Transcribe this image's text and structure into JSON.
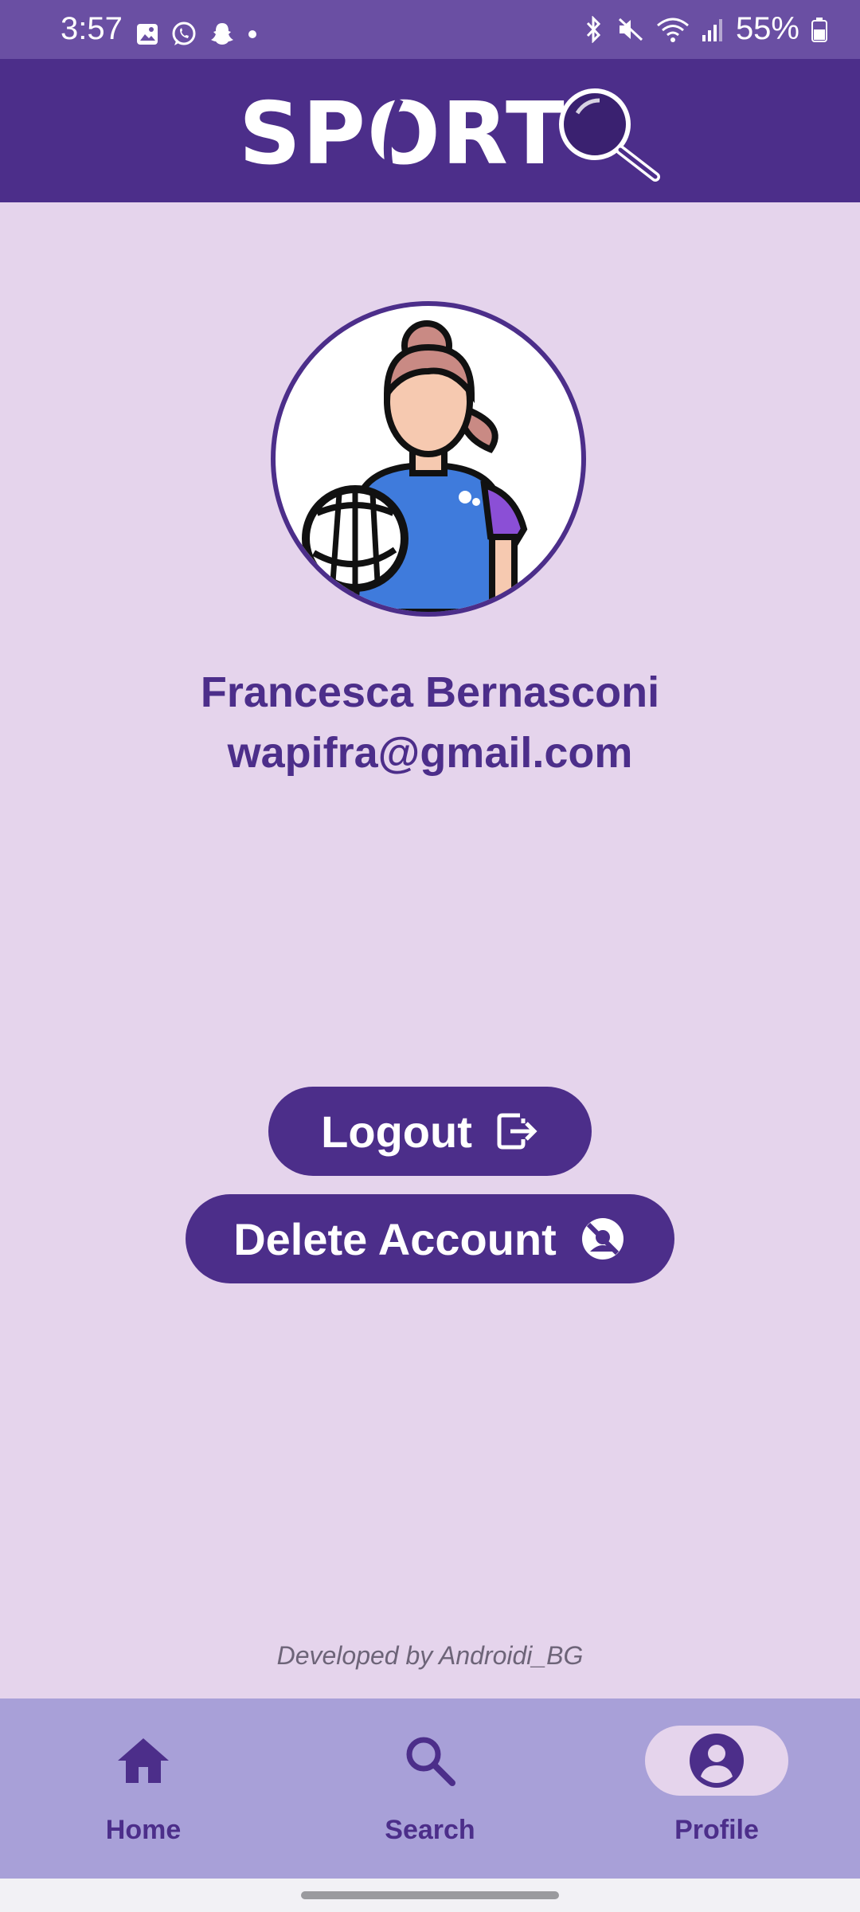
{
  "status_bar": {
    "time": "3:57",
    "battery": "55%",
    "left_icons": [
      "image-icon",
      "whatsapp-icon",
      "snapchat-icon",
      "dot-icon"
    ],
    "right_icons": [
      "bluetooth-icon",
      "mute-icon",
      "wifi-icon",
      "signal-icon",
      "battery-icon"
    ]
  },
  "header": {
    "logo_text": "SPORT"
  },
  "profile": {
    "name": "Francesca Bernasconi",
    "email": "wapifra@gmail.com"
  },
  "actions": {
    "logout_label": "Logout",
    "delete_label": "Delete Account"
  },
  "footer": {
    "credit": "Developed by Androidi_BG"
  },
  "bottom_nav": {
    "items": [
      {
        "label": "Home",
        "icon": "home-icon",
        "active": false
      },
      {
        "label": "Search",
        "icon": "search-icon",
        "active": false
      },
      {
        "label": "Profile",
        "icon": "profile-icon",
        "active": true
      }
    ]
  },
  "colors": {
    "primary": "#4c2e8a",
    "background": "#e5d4ec",
    "status_bar": "#6a4fa3",
    "nav_bar": "#a8a0d8"
  }
}
